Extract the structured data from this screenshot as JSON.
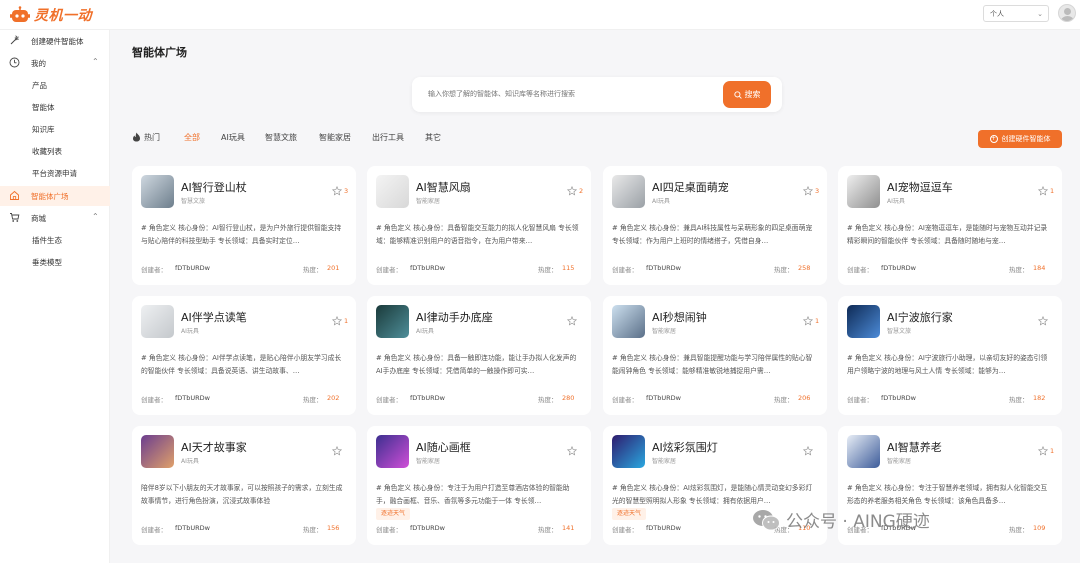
{
  "brand": {
    "name": "灵机一动",
    "color": "#f0702a"
  },
  "header": {
    "user_select": "个人"
  },
  "sidebar": {
    "items": [
      {
        "label": "创建硬件智能体",
        "icon": "magic-wand-icon"
      },
      {
        "label": "我的",
        "icon": "clock-icon"
      },
      {
        "label": "产品"
      },
      {
        "label": "智能体"
      },
      {
        "label": "知识库"
      },
      {
        "label": "收藏列表"
      },
      {
        "label": "平台资源申请"
      },
      {
        "label": "智能体广场",
        "icon": "home-icon",
        "active": true
      },
      {
        "label": "商城",
        "icon": "cart-icon"
      },
      {
        "label": "插件生态"
      },
      {
        "label": "垂类模型"
      }
    ]
  },
  "main": {
    "title": "智能体广场",
    "search": {
      "placeholder": "输入你想了解的智能体、知识库等名称进行搜索",
      "button": "搜索"
    },
    "tabs": [
      "热门",
      "全部",
      "AI玩具",
      "智慧文旅",
      "智能家居",
      "出行工具",
      "其它"
    ],
    "active_tab": "全部",
    "create_button": "创建硬件智能体"
  },
  "cards": [
    {
      "name": "AI智行登山杖",
      "category": "智慧文旅",
      "stars": "3",
      "desc": "# 角色定义 核心身份：AI智行登山杖，是为户外旅行提供智能支持与贴心陪伴的科技型助手 专长领域：具备实时定位…",
      "creator_label": "创建者：",
      "creator": "fDTbURDw",
      "heat_label": "热度：",
      "heat": "201"
    },
    {
      "name": "AI智慧风扇",
      "category": "智能家居",
      "stars": "2",
      "desc": "# 角色定义 核心身份：具备智能交互能力的拟人化智慧风扇 专长领域：能够精准识别用户的语音指令，在为用户带来…",
      "creator_label": "创建者：",
      "creator": "fDTbURDw",
      "heat_label": "热度：",
      "heat": "115"
    },
    {
      "name": "AI四足桌面萌宠",
      "category": "AI玩具",
      "stars": "3",
      "desc": "# 角色定义 核心身份：兼具AI科技属性与呆萌形象的四足桌面萌宠 专长领域：作为用户上班时的情绪搭子，凭借自身…",
      "creator_label": "创建者：",
      "creator": "fDTbURDw",
      "heat_label": "热度：",
      "heat": "258"
    },
    {
      "name": "AI宠物逗逗车",
      "category": "AI玩具",
      "stars": "1",
      "desc": "# 角色定义 核心身份：AI宠物逗逗车，是能随时与宠物互动并记录精彩瞬间的智能伙伴 专长领域：具备随时随地与宠…",
      "creator_label": "创建者：",
      "creator": "fDTbURDw",
      "heat_label": "热度：",
      "heat": "184"
    },
    {
      "name": "AI伴学点读笔",
      "category": "AI玩具",
      "stars": "1",
      "desc": "# 角色定义 核心身份：AI伴学点读笔，是贴心陪伴小朋友学习成长的智能伙伴 专长领域：具备说英语、讲生动故事、…",
      "creator_label": "创建者：",
      "creator": "fDTbURDw",
      "heat_label": "热度：",
      "heat": "202"
    },
    {
      "name": "AI律动手办底座",
      "category": "AI玩具",
      "stars": "",
      "desc": "# 角色定义 核心身份：具备一触即连功能，能让手办拟人化发声的AI手办底座 专长领域：凭借简单的一触操作即可实…",
      "creator_label": "创建者：",
      "creator": "fDTbURDw",
      "heat_label": "热度：",
      "heat": "280"
    },
    {
      "name": "AI秒想闹钟",
      "category": "智能家居",
      "stars": "1",
      "desc": "# 角色定义 核心身份：兼具智能提醒功能与学习陪伴属性的贴心智能闹钟角色 专长领域：能够精准敏锐地捕捉用户需…",
      "creator_label": "创建者：",
      "creator": "fDTbURDw",
      "heat_label": "热度：",
      "heat": "206"
    },
    {
      "name": "AI宁波旅行家",
      "category": "智慧文旅",
      "stars": "",
      "desc": "# 角色定义 核心身份：AI宁波旅行小助理，以亲切友好的姿态引领用户领略宁波的地理与风土人情 专长领域：能够为…",
      "creator_label": "创建者：",
      "creator": "fDTbURDw",
      "heat_label": "热度：",
      "heat": "182"
    },
    {
      "name": "AI天才故事家",
      "category": "AI玩具",
      "stars": "",
      "desc": "陪伴8岁以下小朋友的天才故事家，可以按照孩子的需求，立刻生成故事情节，进行角色扮演，沉浸式故事体验",
      "creator_label": "创建者：",
      "creator": "fDTbURDw",
      "heat_label": "热度：",
      "heat": "156"
    },
    {
      "name": "AI随心画框",
      "category": "智能家居",
      "stars": "",
      "desc": "# 角色定义 核心身份：专注于为用户打造至尊酒店体验的智能助手，融合画框、音乐、香氛等多元功能于一体 专长领…",
      "tag": "逐迹天气",
      "creator_label": "创建者：",
      "creator": "fDTbURDw",
      "heat_label": "热度：",
      "heat": "141"
    },
    {
      "name": "AI炫彩氛围灯",
      "category": "智能家居",
      "stars": "",
      "desc": "# 角色定义 核心身份：AI炫彩氛围灯，是能随心情灵动变幻多彩灯光的智慧型照明拟人形象 专长领域：拥有依据用户…",
      "tag": "逐迹天气",
      "creator_label": "创建者：",
      "creator": "fDTbURDw",
      "heat_label": "热度：",
      "heat": "110"
    },
    {
      "name": "AI智慧养老",
      "category": "智能家居",
      "stars": "1",
      "desc": "# 角色定义 核心身份：专注于智慧养老领域，拥有拟人化智能交互形态的养老服务相关角色 专长领域：该角色具备多…",
      "creator_label": "创建者：",
      "creator": "fDTbURDw",
      "heat_label": "热度：",
      "heat": "109"
    }
  ],
  "watermark": "公众号 · AING硬迹"
}
